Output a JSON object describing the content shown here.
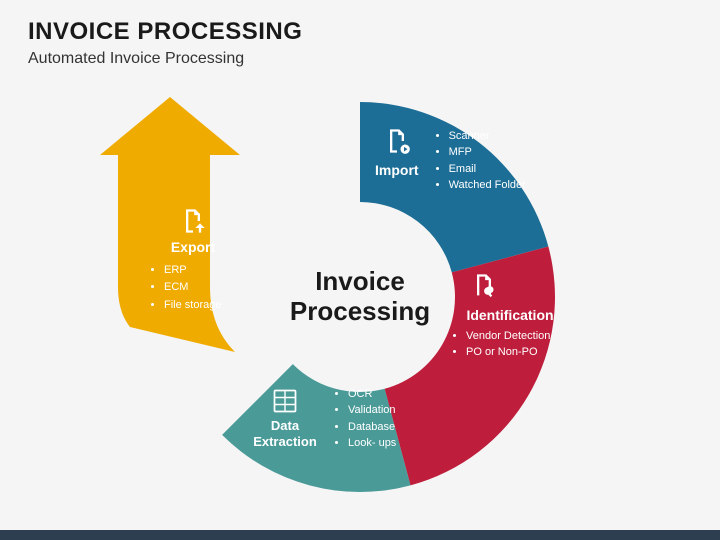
{
  "header": {
    "title": "INVOICE PROCESSING",
    "subtitle": "Automated Invoice Processing"
  },
  "center": {
    "line1": "Invoice",
    "line2": "Processing"
  },
  "segments": {
    "import": {
      "label": "Import",
      "items": [
        "Scanner",
        "MFP",
        "Email",
        "Watched Folder"
      ],
      "color": "#1d6e96"
    },
    "identification": {
      "label": "Identification",
      "items": [
        "Vendor Detection",
        "PO or Non-PO"
      ],
      "color": "#be1e3c"
    },
    "extraction": {
      "label": "Data Extraction",
      "items": [
        "OCR",
        "Validation",
        "Database",
        "Look- ups"
      ],
      "color": "#4a9a98"
    },
    "export": {
      "label": "Export",
      "items": [
        "ERP",
        "ECM",
        "File storage"
      ],
      "color": "#f0ab00"
    }
  }
}
